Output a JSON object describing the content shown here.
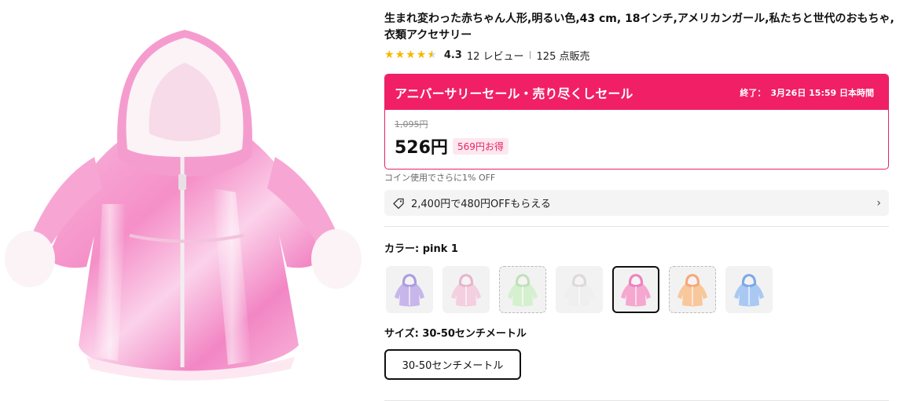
{
  "product": {
    "title": "生まれ変わった赤ちゃん人形,明るい色,43 cm, 18インチ,アメリカンガール,私たちと世代のおもちゃ,衣類アクセサリー",
    "image_alt": "pink iridescent doll hooded coat with white fur trim"
  },
  "rating": {
    "stars": 4.3,
    "value_label": "4.3",
    "reviews_label": "12 レビュー",
    "sold_label": "125 点販売"
  },
  "sale": {
    "title": "アニバーサリーセール・売り尽くしセール",
    "end_prefix": "終了：",
    "end_time": "3月26日 15:59 日本時間",
    "original_price": "1,095円",
    "price": "526円",
    "savings": "569円お得",
    "accent_color": "#f01f66"
  },
  "coin_note": "コイン使用でさらに1% OFF",
  "coupon": {
    "text": "2,400円で480円OFFもらえる",
    "icon": "tag-icon"
  },
  "color": {
    "label": "カラー: pink 1",
    "selected_index": 4,
    "options": [
      {
        "name": "purple",
        "main": "#c7b6ea",
        "shade": "#a99ee0"
      },
      {
        "name": "light pink",
        "main": "#f3cfe0",
        "shade": "#e6b6cb"
      },
      {
        "name": "green",
        "main": "#d4f0cf",
        "shade": "#bfe2b8"
      },
      {
        "name": "white",
        "main": "#efefef",
        "shade": "#dadada"
      },
      {
        "name": "pink 1",
        "main": "#f5a7d0",
        "shade": "#ee82bf"
      },
      {
        "name": "orange",
        "main": "#f8c79b",
        "shade": "#f4aa7a"
      },
      {
        "name": "blue",
        "main": "#a9c9f2",
        "shade": "#7ea9e8"
      }
    ]
  },
  "size": {
    "label": "サイズ: 30-50センチメートル",
    "option": "30-50センチメートル"
  }
}
